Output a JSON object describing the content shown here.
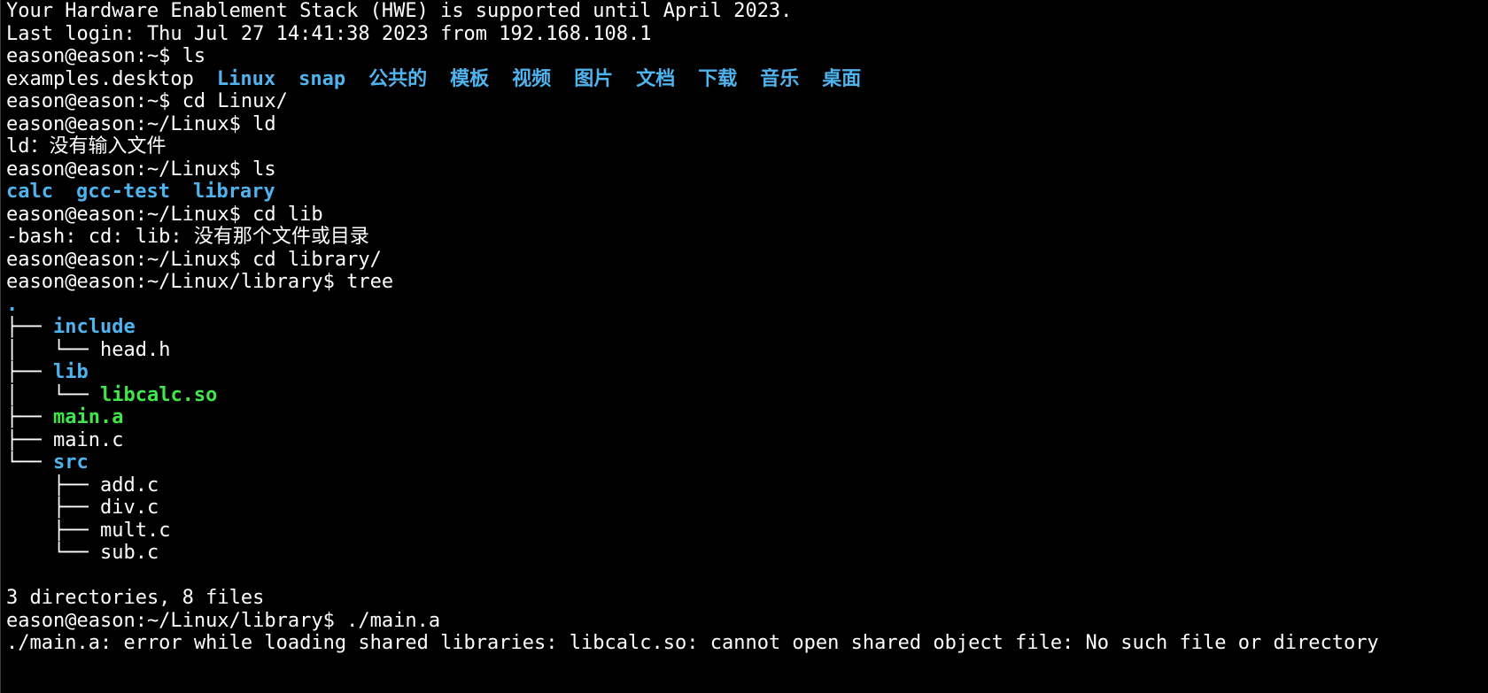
{
  "terminal": {
    "lines": [
      {
        "kind": "text",
        "text": "Your Hardware Enablement Stack (HWE) is supported until April 2023."
      },
      {
        "kind": "text",
        "text": "Last login: Thu Jul 27 14:41:38 2023 from 192.168.108.1"
      },
      {
        "kind": "prompt",
        "prompt": "eason@eason:~$ ",
        "command": "ls"
      },
      {
        "kind": "listing",
        "items": [
          {
            "text": "examples.desktop",
            "type": "file"
          },
          {
            "text": "Linux",
            "type": "dir"
          },
          {
            "text": "snap",
            "type": "dir"
          },
          {
            "text": "公共的",
            "type": "dir"
          },
          {
            "text": "模板",
            "type": "dir"
          },
          {
            "text": "视频",
            "type": "dir"
          },
          {
            "text": "图片",
            "type": "dir"
          },
          {
            "text": "文档",
            "type": "dir"
          },
          {
            "text": "下载",
            "type": "dir"
          },
          {
            "text": "音乐",
            "type": "dir"
          },
          {
            "text": "桌面",
            "type": "dir"
          }
        ]
      },
      {
        "kind": "prompt",
        "prompt": "eason@eason:~$ ",
        "command": "cd Linux/"
      },
      {
        "kind": "prompt",
        "prompt": "eason@eason:~/Linux$ ",
        "command": "ld"
      },
      {
        "kind": "text",
        "text": "ld：没有输入文件"
      },
      {
        "kind": "prompt",
        "prompt": "eason@eason:~/Linux$ ",
        "command": "ls"
      },
      {
        "kind": "listing",
        "items": [
          {
            "text": "calc",
            "type": "dir"
          },
          {
            "text": "gcc-test",
            "type": "dir"
          },
          {
            "text": "library",
            "type": "dir"
          }
        ]
      },
      {
        "kind": "prompt",
        "prompt": "eason@eason:~/Linux$ ",
        "command": "cd lib"
      },
      {
        "kind": "text",
        "text": "-bash: cd: lib: 没有那个文件或目录"
      },
      {
        "kind": "prompt",
        "prompt": "eason@eason:~/Linux$ ",
        "command": "cd library/"
      },
      {
        "kind": "prompt",
        "prompt": "eason@eason:~/Linux/library$ ",
        "command": "tree"
      },
      {
        "kind": "tree",
        "branch": "",
        "name": ".",
        "type": "dir"
      },
      {
        "kind": "tree",
        "branch": "├── ",
        "name": "include",
        "type": "dir"
      },
      {
        "kind": "tree",
        "branch": "│   └── ",
        "name": "head.h",
        "type": "file"
      },
      {
        "kind": "tree",
        "branch": "├── ",
        "name": "lib",
        "type": "dir"
      },
      {
        "kind": "tree",
        "branch": "│   └── ",
        "name": "libcalc.so",
        "type": "exe"
      },
      {
        "kind": "tree",
        "branch": "├── ",
        "name": "main.a",
        "type": "exe"
      },
      {
        "kind": "tree",
        "branch": "├── ",
        "name": "main.c",
        "type": "file"
      },
      {
        "kind": "tree",
        "branch": "└── ",
        "name": "src",
        "type": "dir"
      },
      {
        "kind": "tree",
        "branch": "    ├── ",
        "name": "add.c",
        "type": "file"
      },
      {
        "kind": "tree",
        "branch": "    ├── ",
        "name": "div.c",
        "type": "file"
      },
      {
        "kind": "tree",
        "branch": "    ├── ",
        "name": "mult.c",
        "type": "file"
      },
      {
        "kind": "tree",
        "branch": "    └── ",
        "name": "sub.c",
        "type": "file"
      },
      {
        "kind": "text",
        "text": ""
      },
      {
        "kind": "text",
        "text": "3 directories, 8 files"
      },
      {
        "kind": "prompt",
        "prompt": "eason@eason:~/Linux/library$ ",
        "command": "./main.a"
      },
      {
        "kind": "text",
        "text": "./main.a: error while loading shared libraries: libcalc.so: cannot open shared object file: No such file or directory"
      }
    ]
  },
  "colors": {
    "background": "#000000",
    "foreground": "#ffffff",
    "directory": "#4fb3ee",
    "executable": "#3fe74a"
  }
}
